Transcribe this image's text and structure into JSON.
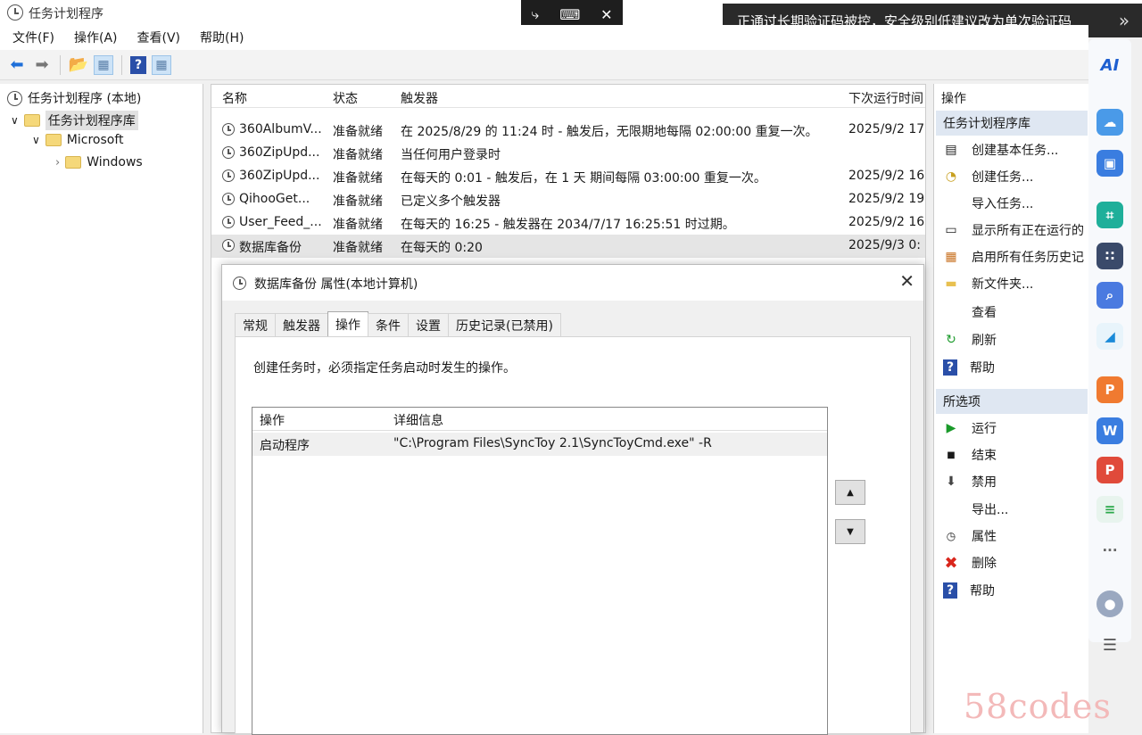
{
  "window": {
    "title": "任务计划程序"
  },
  "remote_controls": {
    "pointer": "⤷",
    "keyboard": "⌨",
    "close": "✕"
  },
  "banner": {
    "text": "正通过长期验证码被控，安全级别低建议改为单次验证码",
    "chevron": "»"
  },
  "menu": [
    "文件(F)",
    "操作(A)",
    "查看(V)",
    "帮助(H)"
  ],
  "toolbar": {
    "back": "⬅",
    "forward": "➡",
    "up": "📂",
    "view": "▦",
    "help": "?",
    "view2": "▦"
  },
  "tree": {
    "root": "任务计划程序 (本地)",
    "library": "任务计划程序库",
    "child": "Microsoft",
    "grandchild": "Windows",
    "expand_open": "∨",
    "expand_closed": "›"
  },
  "task_list": {
    "columns": [
      "名称",
      "状态",
      "触发器",
      "下次运行时间"
    ],
    "rows": [
      {
        "name": "360AlbumV...",
        "status": "准备就绪",
        "trigger": "在 2025/8/29 的 11:24 时 - 触发后，无限期地每隔 02:00:00 重复一次。",
        "next": "2025/9/2 17"
      },
      {
        "name": "360ZipUpd...",
        "status": "准备就绪",
        "trigger": "当任何用户登录时",
        "next": ""
      },
      {
        "name": "360ZipUpd...",
        "status": "准备就绪",
        "trigger": "在每天的 0:01 - 触发后，在 1 天 期间每隔 03:00:00 重复一次。",
        "next": "2025/9/2 16"
      },
      {
        "name": "QihooGet...",
        "status": "准备就绪",
        "trigger": "已定义多个触发器",
        "next": "2025/9/2 19"
      },
      {
        "name": "User_Feed_...",
        "status": "准备就绪",
        "trigger": "在每天的 16:25 - 触发器在 2034/7/17 16:25:51 时过期。",
        "next": "2025/9/2 16"
      },
      {
        "name": "数据库备份",
        "status": "准备就绪",
        "trigger": "在每天的 0:20",
        "next": "2025/9/3 0:"
      }
    ]
  },
  "dialog": {
    "title": "数据库备份 属性(本地计算机)",
    "close": "✕",
    "tabs": [
      "常规",
      "触发器",
      "操作",
      "条件",
      "设置",
      "历史记录(已禁用)"
    ],
    "active_tab": "操作",
    "description": "创建任务时，必须指定任务启动时发生的操作。",
    "table": {
      "columns": [
        "操作",
        "详细信息"
      ],
      "rows": [
        {
          "action": "启动程序",
          "detail": "\"C:\\Program Files\\SyncToy 2.1\\SyncToyCmd.exe\" -R"
        }
      ]
    },
    "move_up": "▲",
    "move_down": "▼"
  },
  "actions_panel": {
    "header": "操作",
    "section1": "任务计划程序库",
    "items1": [
      {
        "icon": "create-basic-task-icon",
        "glyph": "▤",
        "label": "创建基本任务..."
      },
      {
        "icon": "create-task-icon",
        "glyph": "◔",
        "label": "创建任务..."
      },
      {
        "icon": "",
        "glyph": "",
        "label": "导入任务..."
      },
      {
        "icon": "running-tasks-icon",
        "glyph": "▭",
        "label": "显示所有正在运行的"
      },
      {
        "icon": "history-icon",
        "glyph": "▦",
        "label": "启用所有任务历史记"
      },
      {
        "icon": "folder-icon",
        "glyph": "▬",
        "label": "新文件夹..."
      },
      {
        "icon": "",
        "glyph": "",
        "label": "查看"
      },
      {
        "icon": "refresh-icon",
        "glyph": "↻",
        "label": "刷新"
      },
      {
        "icon": "help-icon",
        "glyph": "?",
        "label": "帮助"
      }
    ],
    "section2": "所选项",
    "items2": [
      {
        "icon": "run-icon",
        "glyph": "▶",
        "label": "运行"
      },
      {
        "icon": "end-icon",
        "glyph": "■",
        "label": "结束"
      },
      {
        "icon": "disable-icon",
        "glyph": "⬇",
        "label": "禁用"
      },
      {
        "icon": "",
        "glyph": "",
        "label": "导出..."
      },
      {
        "icon": "properties-icon",
        "glyph": "◷",
        "label": "属性"
      },
      {
        "icon": "delete-icon",
        "glyph": "✖",
        "label": "删除"
      },
      {
        "icon": "help-icon",
        "glyph": "?",
        "label": "帮助"
      }
    ]
  },
  "sidebar": {
    "logo": "AI",
    "more": "···",
    "menu": "☰"
  },
  "watermark": "58codes",
  "colors": {
    "accent": "#1e6fd9",
    "delete": "#d9261c",
    "run": "#1a9a2a",
    "banner_bg": "#2a2a2a",
    "watermark": "#f3b9b9"
  }
}
